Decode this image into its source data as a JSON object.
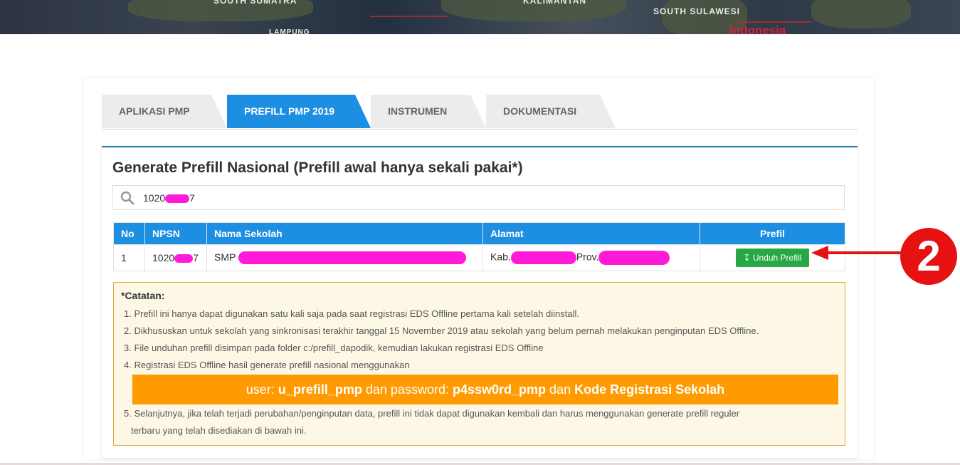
{
  "banner": {
    "label_sumatra": "SOUTH SUMATRA",
    "label_kalimantan": "KALIMANTAN",
    "label_sulawesi": "SOUTH SULAWESI",
    "label_lampung": "LAMPUNG",
    "label_country": "Indonesia"
  },
  "tabs": [
    "APLIKASI PMP",
    "PREFILL PMP 2019",
    "INSTRUMEN",
    "DOKUMENTASI"
  ],
  "active_tab": "PREFILL PMP 2019",
  "panel": {
    "title": "Generate Prefill Nasional (Prefill awal hanya sekali pakai*)"
  },
  "search": {
    "value_prefix": "1020",
    "value_suffix": "7"
  },
  "table": {
    "headers": [
      "No",
      "NPSN",
      "Nama Sekolah",
      "Alamat",
      "Prefil"
    ],
    "row": {
      "no": "1",
      "npsn_prefix": "1020",
      "npsn_suffix": "7",
      "nama_prefix": "SMP",
      "alamat_kab": "Kab.",
      "alamat_prov": "Prov.",
      "button_label": "Unduh Prefill"
    }
  },
  "notes": {
    "title": "*Catatan:",
    "items": [
      "1. Prefill ini hanya dapat digunakan satu kali saja pada saat registrasi EDS Offline pertama kali setelah diinstall.",
      "2. Dikhususkan untuk sekolah yang sinkronisasi terakhir tanggal 15 November 2019 atau sekolah yang belum pernah melakukan penginputan EDS Offline.",
      "3. File unduhan prefill disimpan pada folder c:/prefill_dapodik, kemudian lakukan registrasi EDS Offline",
      "4. Registrasi EDS Offline hasil generate prefill nasional menggunakan",
      "5. Selanjutnya, jika telah terjadi perubahan/penginputan data, prefill ini tidak dapat digunakan kembali dan harus menggunakan generate prefill reguler",
      "terbaru yang telah disediakan di bawah ini."
    ],
    "highlight": {
      "user_label": "user:",
      "user_value": "u_prefill_pmp",
      "and1": "dan password:",
      "password_value": "p4ssw0rd_pmp",
      "and2": "dan",
      "code_value": "Kode Registrasi Sekolah"
    }
  },
  "annotation_badge": "2",
  "colors": {
    "tab_active": "#1d8fe3",
    "table_header": "#1d8fe3",
    "download_button": "#27a844",
    "highlight_bar": "#ff9a00",
    "annotation_red": "#e61111",
    "redaction": "#ff1ad9"
  }
}
